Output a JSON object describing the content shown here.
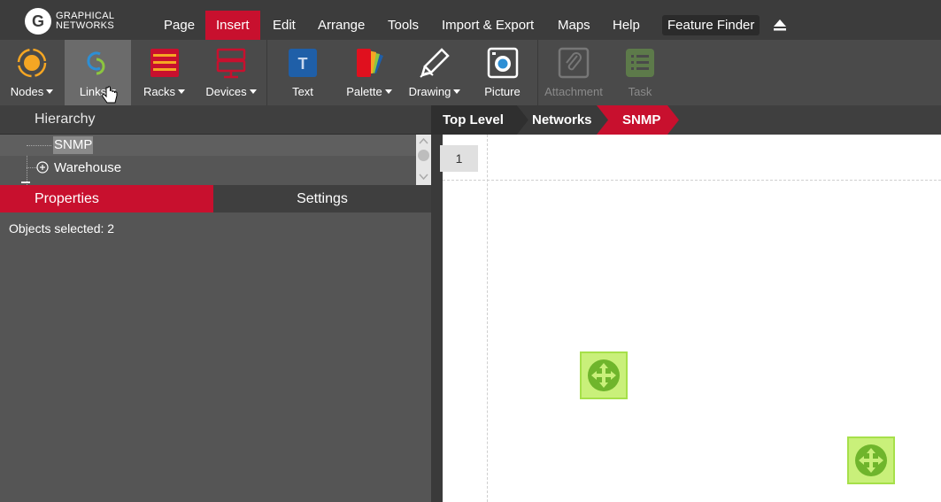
{
  "app": {
    "logo_line1": "GRAPHICAL",
    "logo_line2": "NETWORKS"
  },
  "menubar": {
    "items": [
      "Page",
      "Insert",
      "Edit",
      "Arrange",
      "Tools",
      "Import & Export",
      "Maps",
      "Help"
    ],
    "active": "Insert",
    "feature_finder": "Feature Finder",
    "accent_color": "#c8102e"
  },
  "ribbon": {
    "buttons": [
      {
        "label": "Nodes",
        "icon": "nodes-icon",
        "dropdown": true
      },
      {
        "label": "Links",
        "icon": "links-icon",
        "dropdown": true,
        "active": true
      },
      {
        "label": "Racks",
        "icon": "racks-icon",
        "dropdown": true
      },
      {
        "label": "Devices",
        "icon": "devices-icon",
        "dropdown": true
      },
      {
        "label": "Text",
        "icon": "text-icon",
        "dropdown": false
      },
      {
        "label": "Palette",
        "icon": "palette-icon",
        "dropdown": true
      },
      {
        "label": "Drawing",
        "icon": "drawing-icon",
        "dropdown": true
      },
      {
        "label": "Picture",
        "icon": "picture-icon",
        "dropdown": false
      },
      {
        "label": "Attachment",
        "icon": "attachment-icon",
        "dropdown": false,
        "disabled": true
      },
      {
        "label": "Task",
        "icon": "task-icon",
        "dropdown": false,
        "disabled": true
      }
    ]
  },
  "hierarchy": {
    "title": "Hierarchy",
    "items": [
      {
        "label": "SNMP",
        "selected": true
      },
      {
        "label": "Warehouse",
        "expandable": true
      }
    ]
  },
  "panel_tabs": {
    "properties": "Properties",
    "settings": "Settings",
    "active": "Properties"
  },
  "properties": {
    "status": "Objects selected: 2"
  },
  "breadcrumb": {
    "items": [
      "Top Level",
      "Networks",
      "SNMP"
    ],
    "current": "SNMP"
  },
  "canvas": {
    "page_number": "1",
    "node_color": "#c9f07a",
    "node_count": 2
  }
}
